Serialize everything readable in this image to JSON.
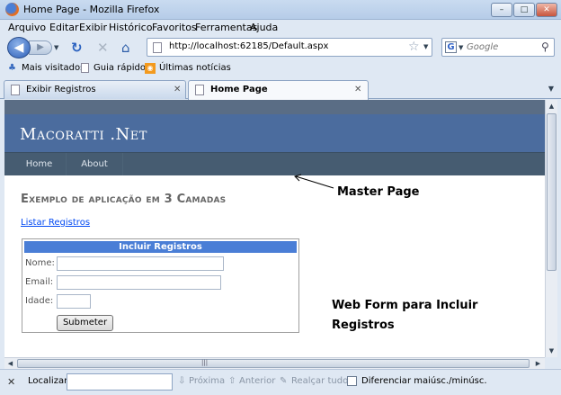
{
  "window": {
    "title": "Home Page - Mozilla Firefox",
    "min": "–",
    "max": "□",
    "close": "✕"
  },
  "menu": [
    "Arquivo",
    "Editar",
    "Exibir",
    "Histórico",
    "Favoritos",
    "Ferramentas",
    "Ajuda"
  ],
  "nav": {
    "url": "http://localhost:62185/Default.aspx",
    "search_placeholder": "Google"
  },
  "bookmarks": [
    "Mais visitados",
    "Guia rápido",
    "Últimas notícias"
  ],
  "tabs": [
    {
      "label": "Exibir Registros",
      "active": false
    },
    {
      "label": "Home Page",
      "active": true
    }
  ],
  "site": {
    "brand": "Macoratti .Net",
    "menu": [
      "Home",
      "About"
    ],
    "heading": "Exemplo de aplicação em 3 Camadas",
    "link": "Listar Registros",
    "form": {
      "title": "Incluir Registros",
      "name_label": "Nome:",
      "email_label": "Email:",
      "age_label": "Idade:",
      "submit": "Submeter"
    }
  },
  "annotations": {
    "master_page": "Master Page",
    "web_form_line1": "Web Form para Incluir",
    "web_form_line2": "Registros"
  },
  "findbar": {
    "label": "Localizar:",
    "next": "Próxima",
    "prev": "Anterior",
    "highlight": "Realçar tudo",
    "case": "Diferenciar maiúsc./minúsc."
  }
}
